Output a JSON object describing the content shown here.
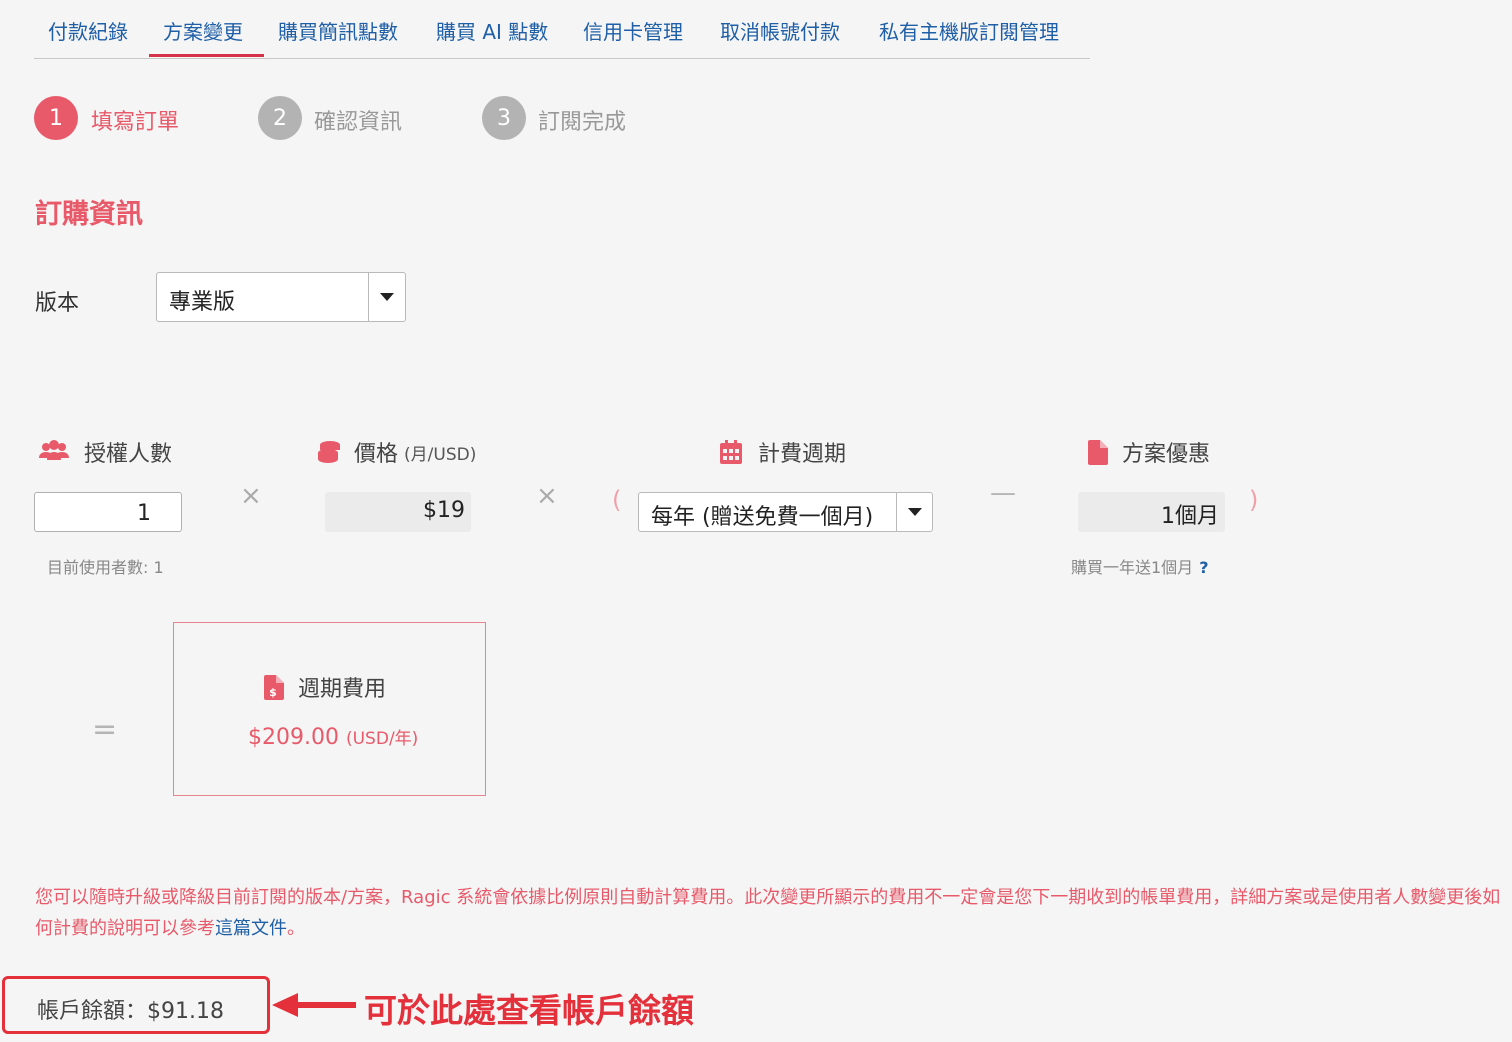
{
  "tabs": [
    {
      "label": "付款紀錄",
      "active": false
    },
    {
      "label": "方案變更",
      "active": true
    },
    {
      "label": "購買簡訊點數",
      "active": false
    },
    {
      "label": "購買 AI 點數",
      "active": false
    },
    {
      "label": "信用卡管理",
      "active": false
    },
    {
      "label": "取消帳號付款",
      "active": false
    },
    {
      "label": "私有主機版訂閱管理",
      "active": false
    }
  ],
  "steps": [
    {
      "number": "1",
      "label": "填寫訂單",
      "active": true
    },
    {
      "number": "2",
      "label": "確認資訊",
      "active": false
    },
    {
      "number": "3",
      "label": "訂閱完成",
      "active": false
    }
  ],
  "section_title": "訂購資訊",
  "version": {
    "label": "版本",
    "selected": "專業版"
  },
  "columns": {
    "users": {
      "label": "授權人數",
      "icon": "users-icon",
      "value": "1",
      "hint": "目前使用者數: 1"
    },
    "price": {
      "label": "價格",
      "unit": "(月/USD)",
      "icon": "coins-icon",
      "value": "$19"
    },
    "cycle": {
      "label": "計費週期",
      "icon": "calendar-icon",
      "selected": "每年 (贈送免費一個月)"
    },
    "discount": {
      "label": "方案優惠",
      "icon": "file-icon",
      "value": "1個月",
      "hint": "購買一年送1個月",
      "help": "?"
    }
  },
  "operators": {
    "times": "×",
    "minus": "—",
    "open_paren": "(",
    "close_paren": ")",
    "equals": "="
  },
  "fee": {
    "title": "週期費用",
    "icon": "invoice-dollar-icon",
    "amount": "$209.00",
    "unit": "(USD/年)"
  },
  "note": {
    "text": "您可以隨時升級或降級目前訂閱的版本/方案，Ragic 系統會依據比例原則自動計算費用。此次變更所顯示的費用不一定會是您下一期收到的帳單費用，詳細方案或是使用者人數變更後如何計費的說明可以參考",
    "link": "這篇文件",
    "end": "。"
  },
  "balance": {
    "text": "帳戶餘額：$91.18"
  },
  "annotation": {
    "text": "可於此處查看帳戶餘額"
  },
  "colors": {
    "accent": "#e85a6a",
    "link": "#1f5fa8",
    "annotation": "#e3303b"
  }
}
